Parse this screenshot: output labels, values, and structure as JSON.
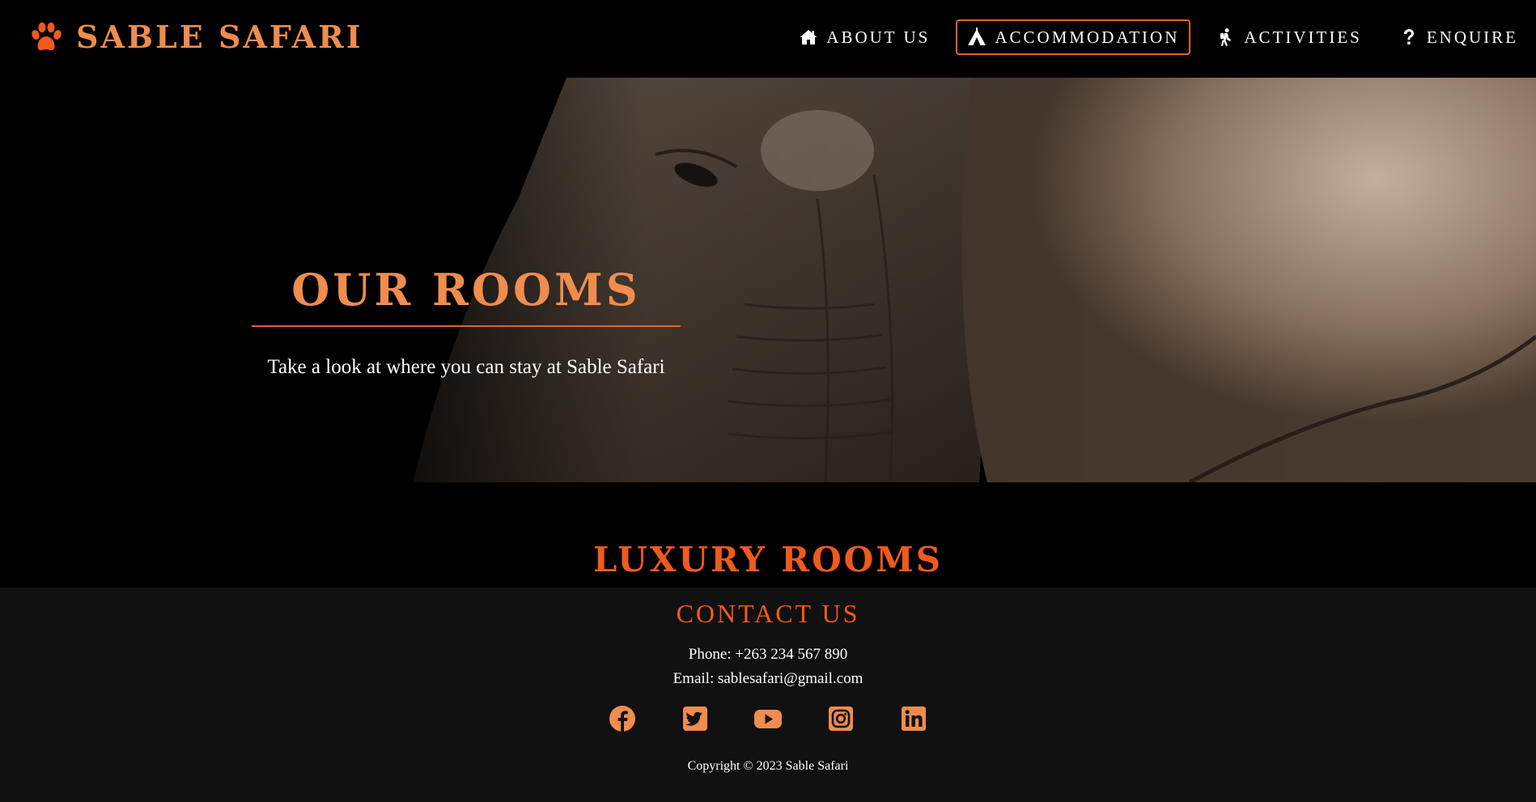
{
  "brand": {
    "name": "SABLE SAFARI",
    "logo_icon": "paw-icon",
    "accent_color": "#ef8c4e",
    "highlight_color": "#f05a1e"
  },
  "nav": {
    "items": [
      {
        "label": "ABOUT US",
        "icon": "home-icon",
        "active": false
      },
      {
        "label": "ACCOMMODATION",
        "icon": "tent-icon",
        "active": true
      },
      {
        "label": "ACTIVITIES",
        "icon": "hiker-icon",
        "active": false
      },
      {
        "label": "ENQUIRE",
        "icon": "question-icon",
        "active": false
      }
    ]
  },
  "hero": {
    "title": "OUR ROOMS",
    "subtitle": "Take a look at where you can stay at Sable Safari",
    "image": "elephant-photo"
  },
  "section": {
    "title": "LUXURY ROOMS"
  },
  "footer": {
    "title": "CONTACT US",
    "phone": "Phone: +263 234 567 890",
    "email": "Email: sablesafari@gmail.com",
    "social": [
      "facebook-icon",
      "twitter-icon",
      "youtube-icon",
      "instagram-icon",
      "linkedin-icon"
    ],
    "copyright": "Copyright © 2023 Sable Safari"
  }
}
